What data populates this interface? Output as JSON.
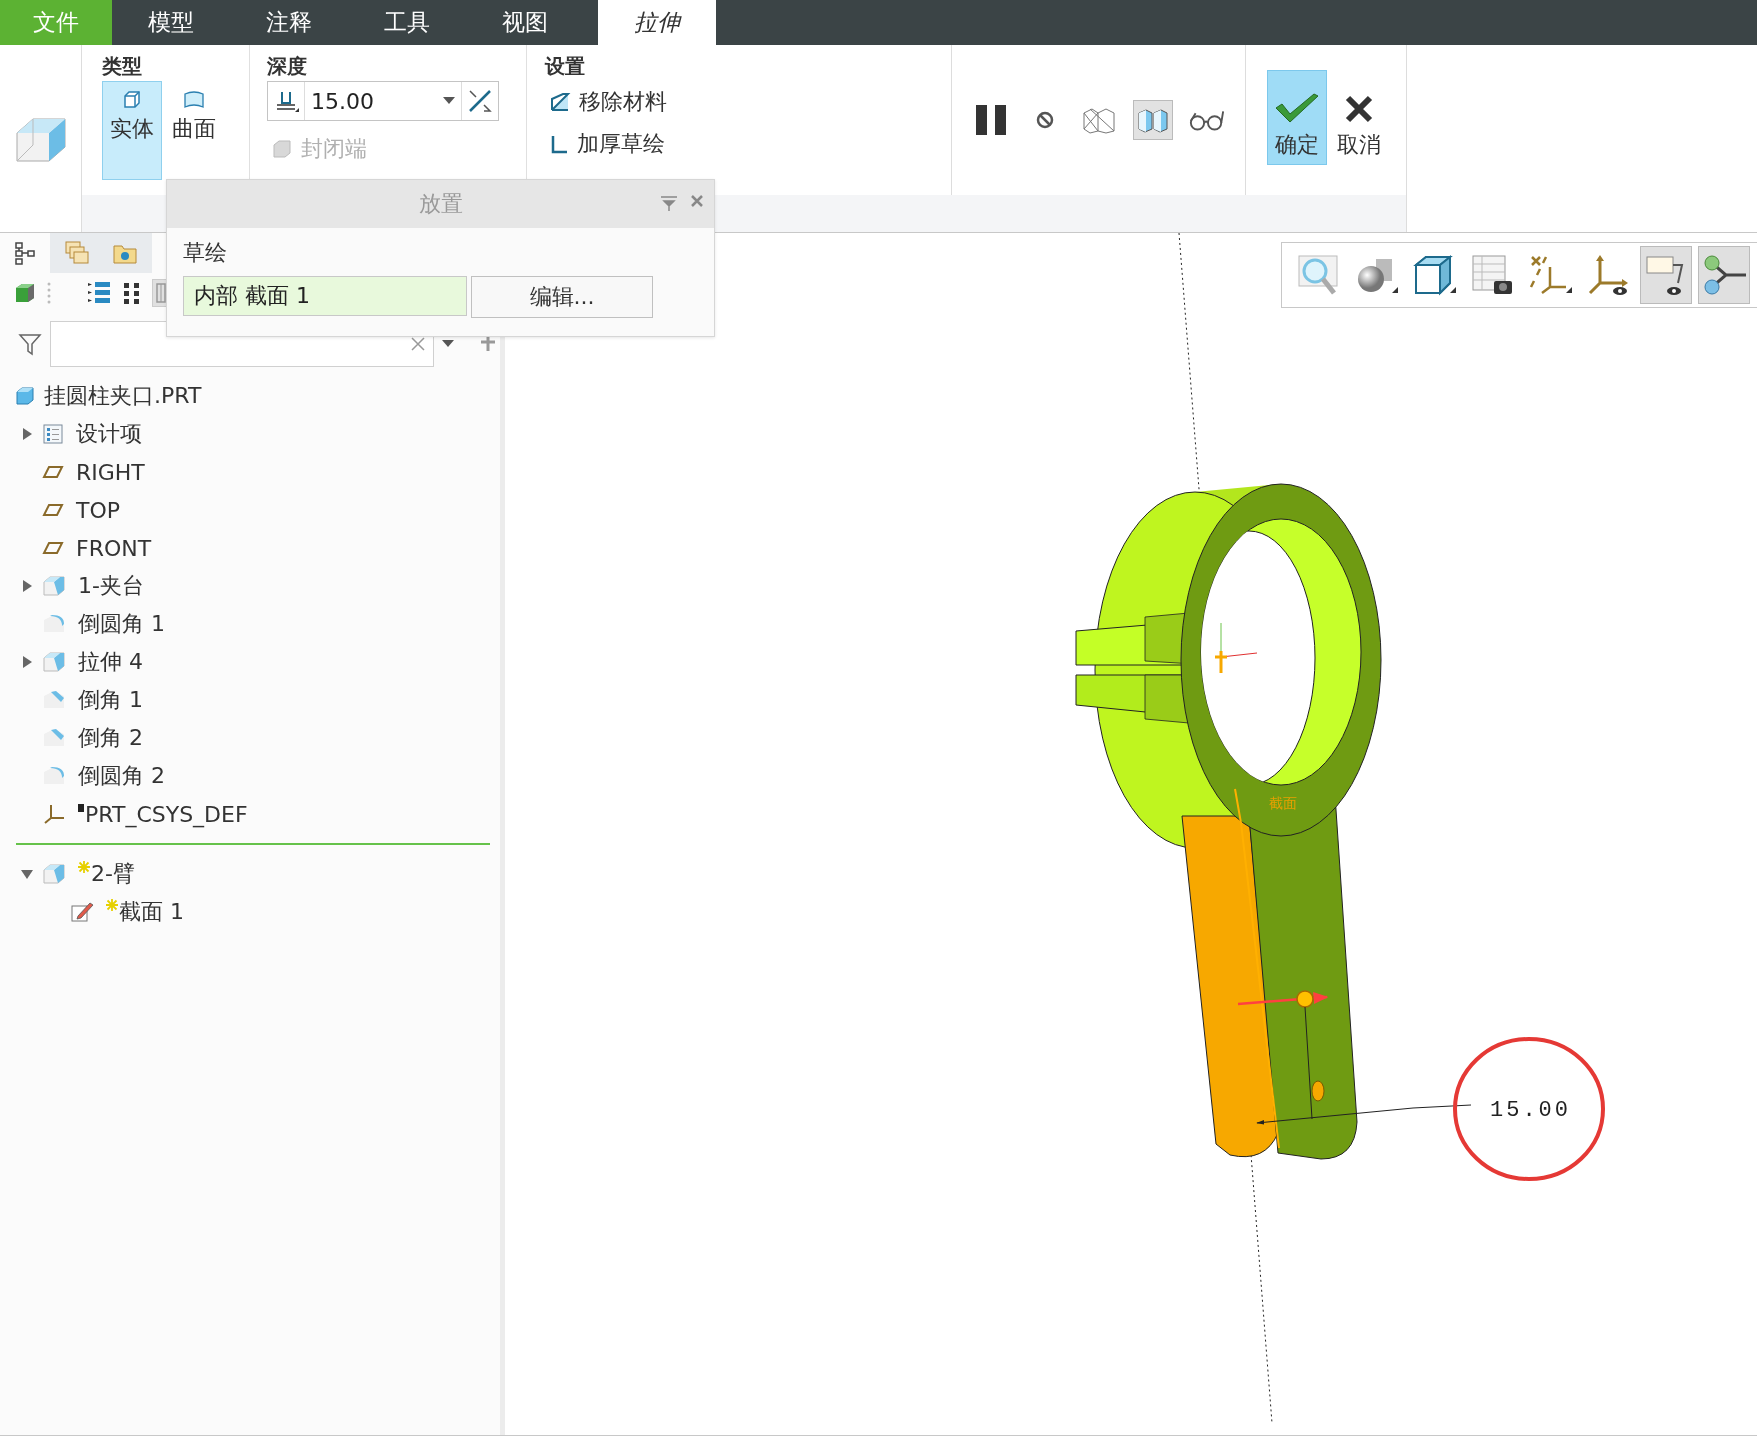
{
  "menu_tabs": [
    {
      "label": "文件",
      "kind": "file",
      "selected": false
    },
    {
      "label": "模型",
      "kind": "tab",
      "selected": false
    },
    {
      "label": "注释",
      "kind": "tab",
      "selected": false
    },
    {
      "label": "工具",
      "kind": "tab",
      "selected": false
    },
    {
      "label": "视图",
      "kind": "tab",
      "selected": false
    },
    {
      "label": "拉伸",
      "kind": "tab",
      "selected": true
    }
  ],
  "ribbon": {
    "type": {
      "title": "类型",
      "options": [
        {
          "label": "实体",
          "kind": "solid",
          "selected": true
        },
        {
          "label": "曲面",
          "kind": "surface",
          "selected": false
        }
      ]
    },
    "depth": {
      "title": "深度",
      "value": "15.00",
      "capped_ends": {
        "label": "封闭端",
        "disabled": true
      }
    },
    "settings": {
      "title": "设置",
      "options": [
        {
          "label": "移除材料",
          "kind": "remove",
          "checked": false
        },
        {
          "label": "加厚草绘",
          "kind": "thicken",
          "checked": false
        }
      ]
    },
    "preview_tools": [
      {
        "kind": "pause",
        "pressed": false
      },
      {
        "kind": "no-preview",
        "pressed": false
      },
      {
        "kind": "geometry-preview",
        "pressed": false
      },
      {
        "kind": "feature-preview",
        "pressed": true
      },
      {
        "kind": "verify",
        "pressed": false
      }
    ],
    "actions": [
      {
        "label": "确定",
        "kind": "ok",
        "selected": true
      },
      {
        "label": "取消",
        "kind": "cancel",
        "selected": false
      }
    ]
  },
  "placement_panel": {
    "title": "放置",
    "section_label": "草绘",
    "sketch": "内部 截面 1",
    "edit_button": "编辑..."
  },
  "model_tree": {
    "label": "挂圆柱夹口.PRT",
    "kind": "part",
    "children": [
      {
        "label": "设计项",
        "kind": "design-items",
        "expanded": false,
        "new": false,
        "flagged": false
      },
      {
        "label": "RIGHT",
        "kind": "plane",
        "new": false,
        "flagged": false
      },
      {
        "label": "TOP",
        "kind": "plane",
        "new": false,
        "flagged": false
      },
      {
        "label": "FRONT",
        "kind": "plane",
        "new": false,
        "flagged": false
      },
      {
        "label": "1-夹台",
        "kind": "extrude",
        "expanded": false,
        "new": false,
        "flagged": false
      },
      {
        "label": "倒圆角 1",
        "kind": "round",
        "new": false,
        "flagged": false
      },
      {
        "label": "拉伸 4",
        "kind": "extrude",
        "expanded": false,
        "new": false,
        "flagged": false
      },
      {
        "label": "倒角 1",
        "kind": "chamfer",
        "new": false,
        "flagged": false
      },
      {
        "label": "倒角 2",
        "kind": "chamfer",
        "new": false,
        "flagged": false
      },
      {
        "label": "倒圆角 2",
        "kind": "round",
        "new": false,
        "flagged": false
      },
      {
        "label": "PRT_CSYS_DEF",
        "kind": "csys",
        "new": false,
        "flagged": true
      },
      {
        "kind": "insert-marker"
      },
      {
        "label": "2-臂",
        "kind": "extrude",
        "expanded": true,
        "new": true,
        "flagged": false,
        "children": [
          {
            "label": "截面 1",
            "kind": "sketch",
            "new": true,
            "flagged": false
          }
        ]
      }
    ]
  },
  "view_toolbar": [
    {
      "kind": "zoom",
      "pressed": false
    },
    {
      "kind": "shading",
      "pressed": false
    },
    {
      "kind": "view-cube",
      "pressed": false
    },
    {
      "kind": "saved-views",
      "pressed": false
    },
    {
      "kind": "datum-display",
      "pressed": false
    },
    {
      "kind": "csys-display",
      "pressed": false
    },
    {
      "kind": "annotation-display",
      "pressed": true
    },
    {
      "kind": "node-display",
      "pressed": true
    }
  ],
  "graphics": {
    "section_tag": "截面",
    "dimension": "15.00"
  }
}
